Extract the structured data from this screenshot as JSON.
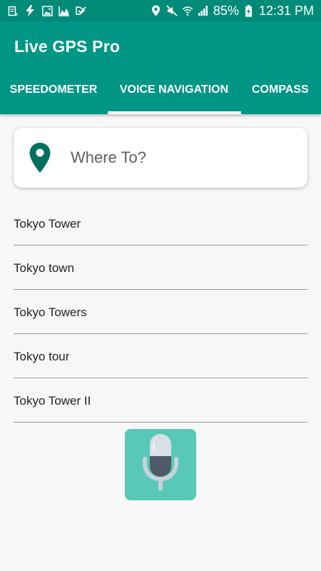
{
  "status_bar": {
    "battery": "85%",
    "time": "12:31 PM",
    "left_icons": [
      "notification-icon",
      "flash-icon",
      "image-icon",
      "chart-icon",
      "download-icon"
    ],
    "right_icons": [
      "location-icon",
      "mute-icon",
      "wifi-icon",
      "signal-icon",
      "battery-icon"
    ]
  },
  "app": {
    "title": "Live GPS Pro",
    "primary_color": "#009685",
    "accent_color": "#58c8b7"
  },
  "tabs": [
    {
      "label": "SPEEDOMETER",
      "selected": false
    },
    {
      "label": "VOICE NAVIGATION",
      "selected": true
    },
    {
      "label": "COMPASS",
      "selected": false
    }
  ],
  "search": {
    "placeholder": "Where To?",
    "value": "",
    "icon": "location-pin-icon"
  },
  "suggestions": [
    "Tokyo Tower",
    "Tokyo town",
    "Tokyo Towers",
    "Tokyo tour",
    "Tokyo Tower II"
  ],
  "mic": {
    "icon": "microphone-icon"
  }
}
